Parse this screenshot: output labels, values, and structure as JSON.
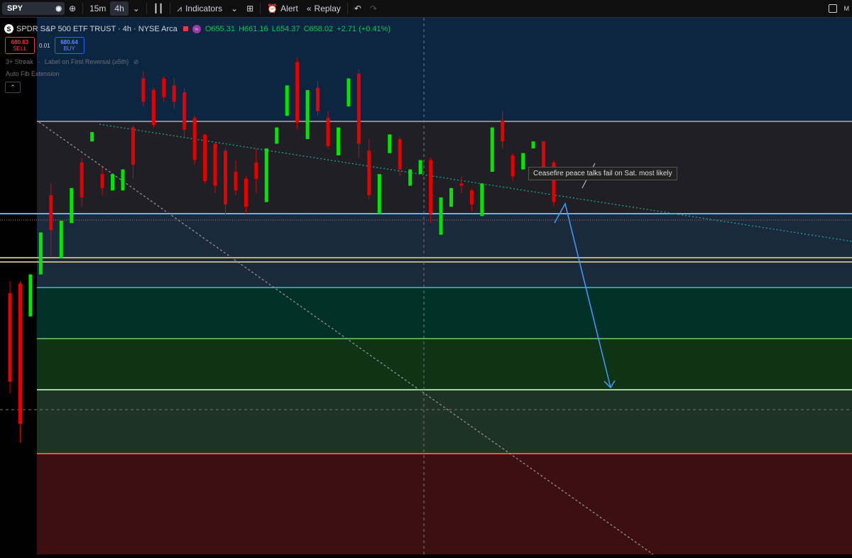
{
  "toolbar": {
    "symbol": "SPY",
    "intervals": [
      "15m",
      "4h"
    ],
    "active_interval": "4h",
    "indicators_label": "Indicators",
    "alert_label": "Alert",
    "replay_label": "Replay",
    "right_letter": "M"
  },
  "legend": {
    "logo_letter": "S",
    "title": "SPDR S&P 500 ETF TRUST · 4h · NYSE Arca",
    "open": "O655.31",
    "high": "H661.16",
    "low": "L654.37",
    "close": "C658.02",
    "change": "+2.71 (+0.41%)"
  },
  "trade": {
    "sell_price": "680.63",
    "sell_label": "SELL",
    "spread": "0.01",
    "buy_price": "680.64",
    "buy_label": "BUY"
  },
  "indicators": {
    "streak": "3+ Streak",
    "streak_setting": "Label on First Reversal (≥5th)",
    "fib": "Auto Fib Extension"
  },
  "annotation": {
    "text": "Ceasefire peace talks fail on Sat. most likely"
  },
  "colors": {
    "up": "#00e600",
    "down": "#e60000",
    "zone_top": "#0c2642",
    "zone_gray": "#1f1f25",
    "zone_blue": "#1a2a3c",
    "zone_teal": "#013028",
    "zone_green": "#103315",
    "zone_green2": "#1f3324",
    "zone_red": "#3c1010",
    "arrow": "#3ca0ff"
  },
  "chart_data": {
    "type": "candlestick",
    "candles": [
      [
        292,
        297,
        254,
        249
      ],
      [
        296,
        297,
        236,
        228
      ],
      [
        282,
        283,
        300,
        302
      ],
      [
        300,
        318,
        318,
        320
      ],
      [
        334,
        339,
        319,
        308
      ],
      [
        307,
        311,
        323,
        327
      ],
      [
        322,
        323,
        337,
        340
      ],
      [
        348,
        350,
        333,
        329
      ],
      [
        357,
        355,
        361,
        366
      ],
      [
        343,
        346,
        337,
        334
      ],
      [
        336,
        336,
        343,
        345
      ],
      [
        336,
        340,
        345,
        349
      ],
      [
        363,
        364,
        347,
        341
      ],
      [
        384,
        387,
        374,
        372
      ],
      [
        379,
        380,
        364,
        363
      ],
      [
        384,
        385,
        376,
        374
      ],
      [
        381,
        384,
        374,
        371
      ],
      [
        378,
        380,
        362,
        359
      ],
      [
        367,
        368,
        349,
        347
      ],
      [
        360,
        360,
        340,
        339
      ],
      [
        356,
        357,
        338,
        335
      ],
      [
        353,
        354,
        330,
        325
      ],
      [
        344,
        349,
        336,
        334
      ],
      [
        341,
        342,
        329,
        326
      ],
      [
        348,
        354,
        341,
        335
      ],
      [
        331,
        335,
        354,
        359
      ],
      [
        356,
        361,
        363,
        366
      ],
      [
        368,
        371,
        381,
        383
      ],
      [
        391,
        393,
        365,
        362
      ],
      [
        358,
        363,
        379,
        381
      ],
      [
        380,
        383,
        370,
        368
      ],
      [
        367,
        370,
        355,
        354
      ],
      [
        351,
        353,
        363,
        368
      ],
      [
        372,
        373,
        384,
        388
      ],
      [
        386,
        388,
        356,
        350
      ],
      [
        353,
        358,
        334,
        332
      ],
      [
        326,
        330,
        343,
        348
      ],
      [
        352,
        353,
        360,
        362
      ],
      [
        358,
        359,
        345,
        342
      ],
      [
        338,
        340,
        345,
        348
      ],
      [
        343,
        343,
        349,
        354
      ],
      [
        349,
        350,
        326,
        322
      ],
      [
        317,
        321,
        333,
        336
      ],
      [
        329,
        332,
        337,
        338
      ],
      [
        339,
        342,
        338,
        335
      ],
      [
        336,
        337,
        330,
        327
      ],
      [
        325,
        328,
        339,
        342
      ],
      [
        344,
        345,
        363,
        365
      ],
      [
        366,
        370,
        357,
        354
      ],
      [
        351,
        352,
        342,
        340
      ],
      [
        345,
        346,
        352,
        354
      ],
      [
        354,
        355,
        357,
        359
      ],
      [
        357,
        357,
        346,
        344
      ],
      [
        348,
        349,
        331,
        329
      ]
    ]
  }
}
